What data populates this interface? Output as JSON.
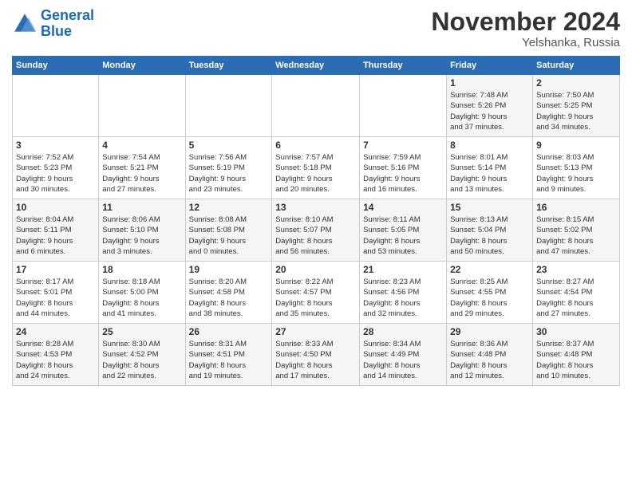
{
  "header": {
    "logo_line1": "General",
    "logo_line2": "Blue",
    "month": "November 2024",
    "location": "Yelshanka, Russia"
  },
  "weekdays": [
    "Sunday",
    "Monday",
    "Tuesday",
    "Wednesday",
    "Thursday",
    "Friday",
    "Saturday"
  ],
  "weeks": [
    [
      {
        "day": "",
        "info": ""
      },
      {
        "day": "",
        "info": ""
      },
      {
        "day": "",
        "info": ""
      },
      {
        "day": "",
        "info": ""
      },
      {
        "day": "",
        "info": ""
      },
      {
        "day": "1",
        "info": "Sunrise: 7:48 AM\nSunset: 5:26 PM\nDaylight: 9 hours\nand 37 minutes."
      },
      {
        "day": "2",
        "info": "Sunrise: 7:50 AM\nSunset: 5:25 PM\nDaylight: 9 hours\nand 34 minutes."
      }
    ],
    [
      {
        "day": "3",
        "info": "Sunrise: 7:52 AM\nSunset: 5:23 PM\nDaylight: 9 hours\nand 30 minutes."
      },
      {
        "day": "4",
        "info": "Sunrise: 7:54 AM\nSunset: 5:21 PM\nDaylight: 9 hours\nand 27 minutes."
      },
      {
        "day": "5",
        "info": "Sunrise: 7:56 AM\nSunset: 5:19 PM\nDaylight: 9 hours\nand 23 minutes."
      },
      {
        "day": "6",
        "info": "Sunrise: 7:57 AM\nSunset: 5:18 PM\nDaylight: 9 hours\nand 20 minutes."
      },
      {
        "day": "7",
        "info": "Sunrise: 7:59 AM\nSunset: 5:16 PM\nDaylight: 9 hours\nand 16 minutes."
      },
      {
        "day": "8",
        "info": "Sunrise: 8:01 AM\nSunset: 5:14 PM\nDaylight: 9 hours\nand 13 minutes."
      },
      {
        "day": "9",
        "info": "Sunrise: 8:03 AM\nSunset: 5:13 PM\nDaylight: 9 hours\nand 9 minutes."
      }
    ],
    [
      {
        "day": "10",
        "info": "Sunrise: 8:04 AM\nSunset: 5:11 PM\nDaylight: 9 hours\nand 6 minutes."
      },
      {
        "day": "11",
        "info": "Sunrise: 8:06 AM\nSunset: 5:10 PM\nDaylight: 9 hours\nand 3 minutes."
      },
      {
        "day": "12",
        "info": "Sunrise: 8:08 AM\nSunset: 5:08 PM\nDaylight: 9 hours\nand 0 minutes."
      },
      {
        "day": "13",
        "info": "Sunrise: 8:10 AM\nSunset: 5:07 PM\nDaylight: 8 hours\nand 56 minutes."
      },
      {
        "day": "14",
        "info": "Sunrise: 8:11 AM\nSunset: 5:05 PM\nDaylight: 8 hours\nand 53 minutes."
      },
      {
        "day": "15",
        "info": "Sunrise: 8:13 AM\nSunset: 5:04 PM\nDaylight: 8 hours\nand 50 minutes."
      },
      {
        "day": "16",
        "info": "Sunrise: 8:15 AM\nSunset: 5:02 PM\nDaylight: 8 hours\nand 47 minutes."
      }
    ],
    [
      {
        "day": "17",
        "info": "Sunrise: 8:17 AM\nSunset: 5:01 PM\nDaylight: 8 hours\nand 44 minutes."
      },
      {
        "day": "18",
        "info": "Sunrise: 8:18 AM\nSunset: 5:00 PM\nDaylight: 8 hours\nand 41 minutes."
      },
      {
        "day": "19",
        "info": "Sunrise: 8:20 AM\nSunset: 4:58 PM\nDaylight: 8 hours\nand 38 minutes."
      },
      {
        "day": "20",
        "info": "Sunrise: 8:22 AM\nSunset: 4:57 PM\nDaylight: 8 hours\nand 35 minutes."
      },
      {
        "day": "21",
        "info": "Sunrise: 8:23 AM\nSunset: 4:56 PM\nDaylight: 8 hours\nand 32 minutes."
      },
      {
        "day": "22",
        "info": "Sunrise: 8:25 AM\nSunset: 4:55 PM\nDaylight: 8 hours\nand 29 minutes."
      },
      {
        "day": "23",
        "info": "Sunrise: 8:27 AM\nSunset: 4:54 PM\nDaylight: 8 hours\nand 27 minutes."
      }
    ],
    [
      {
        "day": "24",
        "info": "Sunrise: 8:28 AM\nSunset: 4:53 PM\nDaylight: 8 hours\nand 24 minutes."
      },
      {
        "day": "25",
        "info": "Sunrise: 8:30 AM\nSunset: 4:52 PM\nDaylight: 8 hours\nand 22 minutes."
      },
      {
        "day": "26",
        "info": "Sunrise: 8:31 AM\nSunset: 4:51 PM\nDaylight: 8 hours\nand 19 minutes."
      },
      {
        "day": "27",
        "info": "Sunrise: 8:33 AM\nSunset: 4:50 PM\nDaylight: 8 hours\nand 17 minutes."
      },
      {
        "day": "28",
        "info": "Sunrise: 8:34 AM\nSunset: 4:49 PM\nDaylight: 8 hours\nand 14 minutes."
      },
      {
        "day": "29",
        "info": "Sunrise: 8:36 AM\nSunset: 4:48 PM\nDaylight: 8 hours\nand 12 minutes."
      },
      {
        "day": "30",
        "info": "Sunrise: 8:37 AM\nSunset: 4:48 PM\nDaylight: 8 hours\nand 10 minutes."
      }
    ]
  ]
}
